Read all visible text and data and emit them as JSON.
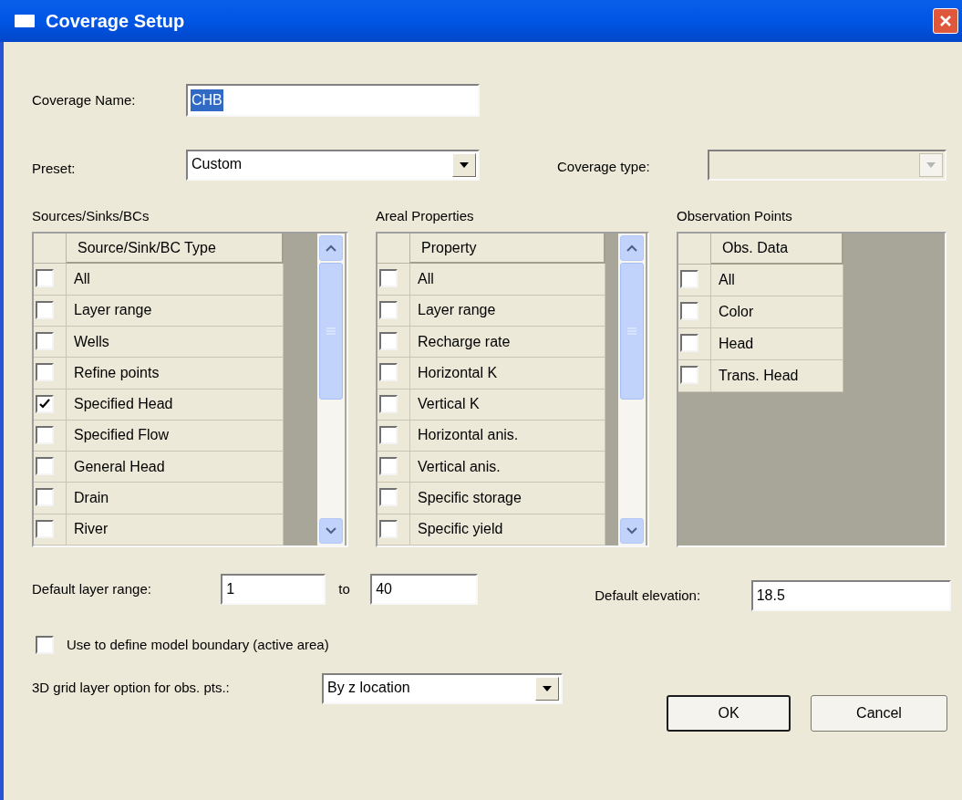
{
  "window": {
    "title": "Coverage Setup"
  },
  "coverage_name": {
    "label": "Coverage Name:",
    "value": "CHB",
    "selected": true
  },
  "preset": {
    "label": "Preset:",
    "value": "Custom"
  },
  "coverage_type": {
    "label": "Coverage type:",
    "disabled": true
  },
  "tables": [
    {
      "title": "Sources/Sinks/BCs",
      "column": "Source/Sink/BC Type",
      "scrollbar": true,
      "rows": [
        {
          "label": "All",
          "checked": false
        },
        {
          "label": "Layer range",
          "checked": false
        },
        {
          "label": "Wells",
          "checked": false
        },
        {
          "label": "Refine points",
          "checked": false
        },
        {
          "label": "Specified Head",
          "checked": true
        },
        {
          "label": "Specified Flow",
          "checked": false
        },
        {
          "label": "General Head",
          "checked": false
        },
        {
          "label": "Drain",
          "checked": false
        },
        {
          "label": "River",
          "checked": false
        }
      ]
    },
    {
      "title": "Areal Properties",
      "column": "Property",
      "scrollbar": true,
      "rows": [
        {
          "label": "All",
          "checked": false
        },
        {
          "label": "Layer range",
          "checked": false
        },
        {
          "label": "Recharge rate",
          "checked": false
        },
        {
          "label": "Horizontal K",
          "checked": false
        },
        {
          "label": "Vertical K",
          "checked": false
        },
        {
          "label": "Horizontal anis.",
          "checked": false
        },
        {
          "label": "Vertical anis.",
          "checked": false
        },
        {
          "label": "Specific storage",
          "checked": false
        },
        {
          "label": "Specific yield",
          "checked": false
        }
      ]
    },
    {
      "title": "Observation Points",
      "column": "Obs. Data",
      "scrollbar": false,
      "rows": [
        {
          "label": "All",
          "checked": false
        },
        {
          "label": "Color",
          "checked": false
        },
        {
          "label": "Head",
          "checked": false
        },
        {
          "label": "Trans. Head",
          "checked": false
        }
      ]
    }
  ],
  "default_layer_range": {
    "label": "Default layer range:",
    "from": "1",
    "to_label": "to",
    "to": "40"
  },
  "default_elevation": {
    "label": "Default elevation:",
    "value": "18.5"
  },
  "model_boundary": {
    "label": "Use to define model boundary (active area)",
    "checked": false
  },
  "grid_layer_option": {
    "label": "3D grid layer option for obs. pts.:",
    "value": "By z location"
  },
  "buttons": [
    "OK",
    "Cancel"
  ]
}
